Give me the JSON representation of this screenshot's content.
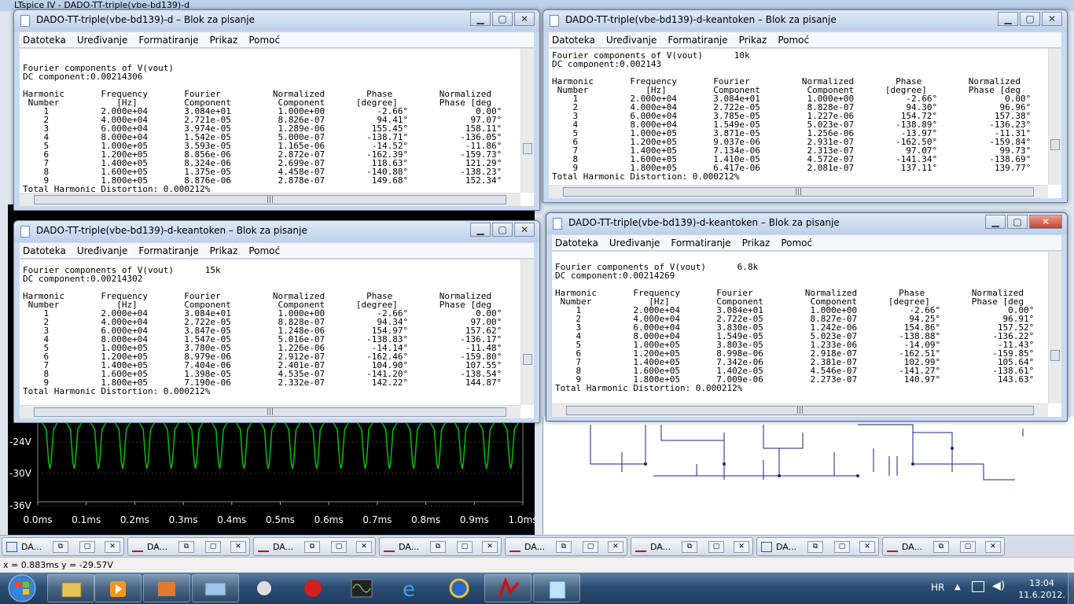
{
  "ltspice": {
    "title": "LTspice IV - DADO-TT-triple(vbe-bd139)-d",
    "y_ticks": [
      "-24V",
      "-30V",
      "-36V"
    ],
    "x_ticks": [
      "0.0ms",
      "0.1ms",
      "0.2ms",
      "0.3ms",
      "0.4ms",
      "0.5ms",
      "0.6ms",
      "0.7ms",
      "0.8ms",
      "0.9ms",
      "1.0ms"
    ],
    "trace_color": "#00c000"
  },
  "notepad_menu": [
    "Datoteka",
    "Uređivanje",
    "Formatiranje",
    "Prikaz",
    "Pomoć"
  ],
  "windows": [
    {
      "title": "DADO-TT-triple(vbe-bd139)-d – Blok za pisanje",
      "content": "\nFourier components of V(vout)\nDC component:0.00214306\n\nHarmonic       Frequency       Fourier          Normalized        Phase         Normalized\n Number           [Hz]         Component         Component      [degree]        Phase [deg\n    1          2.000e+04       3.084e+01         1.000e+00          -2.66°             0.00°\n    2          4.000e+04       2.721e-05         8.826e-07          94.41°            97.07°\n    3          6.000e+04       3.974e-05         1.289e-06         155.45°           158.11°\n    4          8.000e+04       1.542e-05         5.000e-07        -138.71°          -136.05°\n    5          1.000e+05       3.593e-05         1.165e-06         -14.52°           -11.86°\n    6          1.200e+05       8.856e-06         2.872e-07        -162.39°          -159.73°\n    7          1.400e+05       8.324e-06         2.699e-07         118.63°           121.29°\n    8          1.600e+05       1.375e-05         4.458e-07        -140.88°          -138.23°\n    9          1.800e+05       8.876e-06         2.878e-07         149.68°           152.34°\nTotal Harmonic Distortion: 0.000212%"
    },
    {
      "title": "DADO-TT-triple(vbe-bd139)-d-keantoken – Blok za pisanje",
      "content": "Fourier components of V(vout)      10k\nDC component:0.002143\n\nHarmonic       Frequency       Fourier          Normalized        Phase         Normalized\n Number           [Hz]         Component         Component      [degree]        Phase [deg\n    1          2.000e+04       3.084e+01         1.000e+00          -2.66°             0.00°\n    2          4.000e+04       2.722e-05         8.828e-07          94.30°            96.96°\n    3          6.000e+04       3.785e-05         1.227e-06         154.72°           157.38°\n    4          8.000e+04       1.549e-05         5.023e-07        -138.89°          -136.23°\n    5          1.000e+05       3.871e-05         1.256e-06         -13.97°           -11.31°\n    6          1.200e+05       9.037e-06         2.931e-07        -162.50°          -159.84°\n    7          1.400e+05       7.134e-06         2.313e-07          97.07°            99.73°\n    8          1.600e+05       1.410e-05         4.572e-07        -141.34°          -138.69°\n    9          1.800e+05       6.417e-06         2.081e-07         137.11°           139.77°\nTotal Harmonic Distortion: 0.000212%"
    },
    {
      "title": "DADO-TT-triple(vbe-bd139)-d-keantoken – Blok za pisanje",
      "content": "Fourier components of V(vout)      15k\nDC component:0.00214302\n\nHarmonic       Frequency       Fourier          Normalized        Phase         Normalized\n Number           [Hz]         Component         Component      [degree]        Phase [deg\n    1          2.000e+04       3.084e+01         1.000e+00          -2.66°             0.00°\n    2          4.000e+04       2.722e-05         8.828e-07          94.34°            97.00°\n    3          6.000e+04       3.847e-05         1.248e-06         154.97°           157.62°\n    4          8.000e+04       1.547e-05         5.016e-07        -138.83°          -136.17°\n    5          1.000e+05       3.780e-05         1.226e-06         -14.14°           -11.48°\n    6          1.200e+05       8.979e-06         2.912e-07        -162.46°          -159.80°\n    7          1.400e+05       7.404e-06         2.401e-07         104.90°           107.55°\n    8          1.600e+05       1.398e-05         4.535e-07        -141.20°          -138.54°\n    9          1.800e+05       7.190e-06         2.332e-07         142.22°           144.87°\nTotal Harmonic Distortion: 0.000212%"
    },
    {
      "title": "DADO-TT-triple(vbe-bd139)-d-keantoken – Blok za pisanje",
      "content": "Fourier components of V(vout)      6.8k\nDC component:0.00214269\n\nHarmonic       Frequency       Fourier          Normalized        Phase         Normalized\n Number           [Hz]         Component         Component      [degree]        Phase [deg\n    1          2.000e+04       3.084e+01         1.000e+00          -2.66°             0.00°\n    2          4.000e+04       2.722e-05         8.827e-07          94.25°            96.91°\n    3          6.000e+04       3.830e-05         1.242e-06         154.86°           157.52°\n    4          8.000e+04       1.549e-05         5.023e-07        -138.88°          -136.22°\n    5          1.000e+05       3.803e-05         1.233e-06         -14.09°           -11.43°\n    6          1.200e+05       8.998e-06         2.918e-07        -162.51°          -159.85°\n    7          1.400e+05       7.342e-06         2.381e-07         102.99°           105.64°\n    8          1.600e+05       1.402e-05         4.546e-07        -141.27°          -138.61°\n    9          1.800e+05       7.009e-06         2.273e-07         140.97°           143.63°\nTotal Harmonic Distortion: 0.000212%"
    }
  ],
  "mdi_label": "DA...",
  "status": "x = 0.883ms   y = -29.57V",
  "tray": {
    "lang": "HR",
    "time": "13:04",
    "date": "11.6.2012."
  }
}
